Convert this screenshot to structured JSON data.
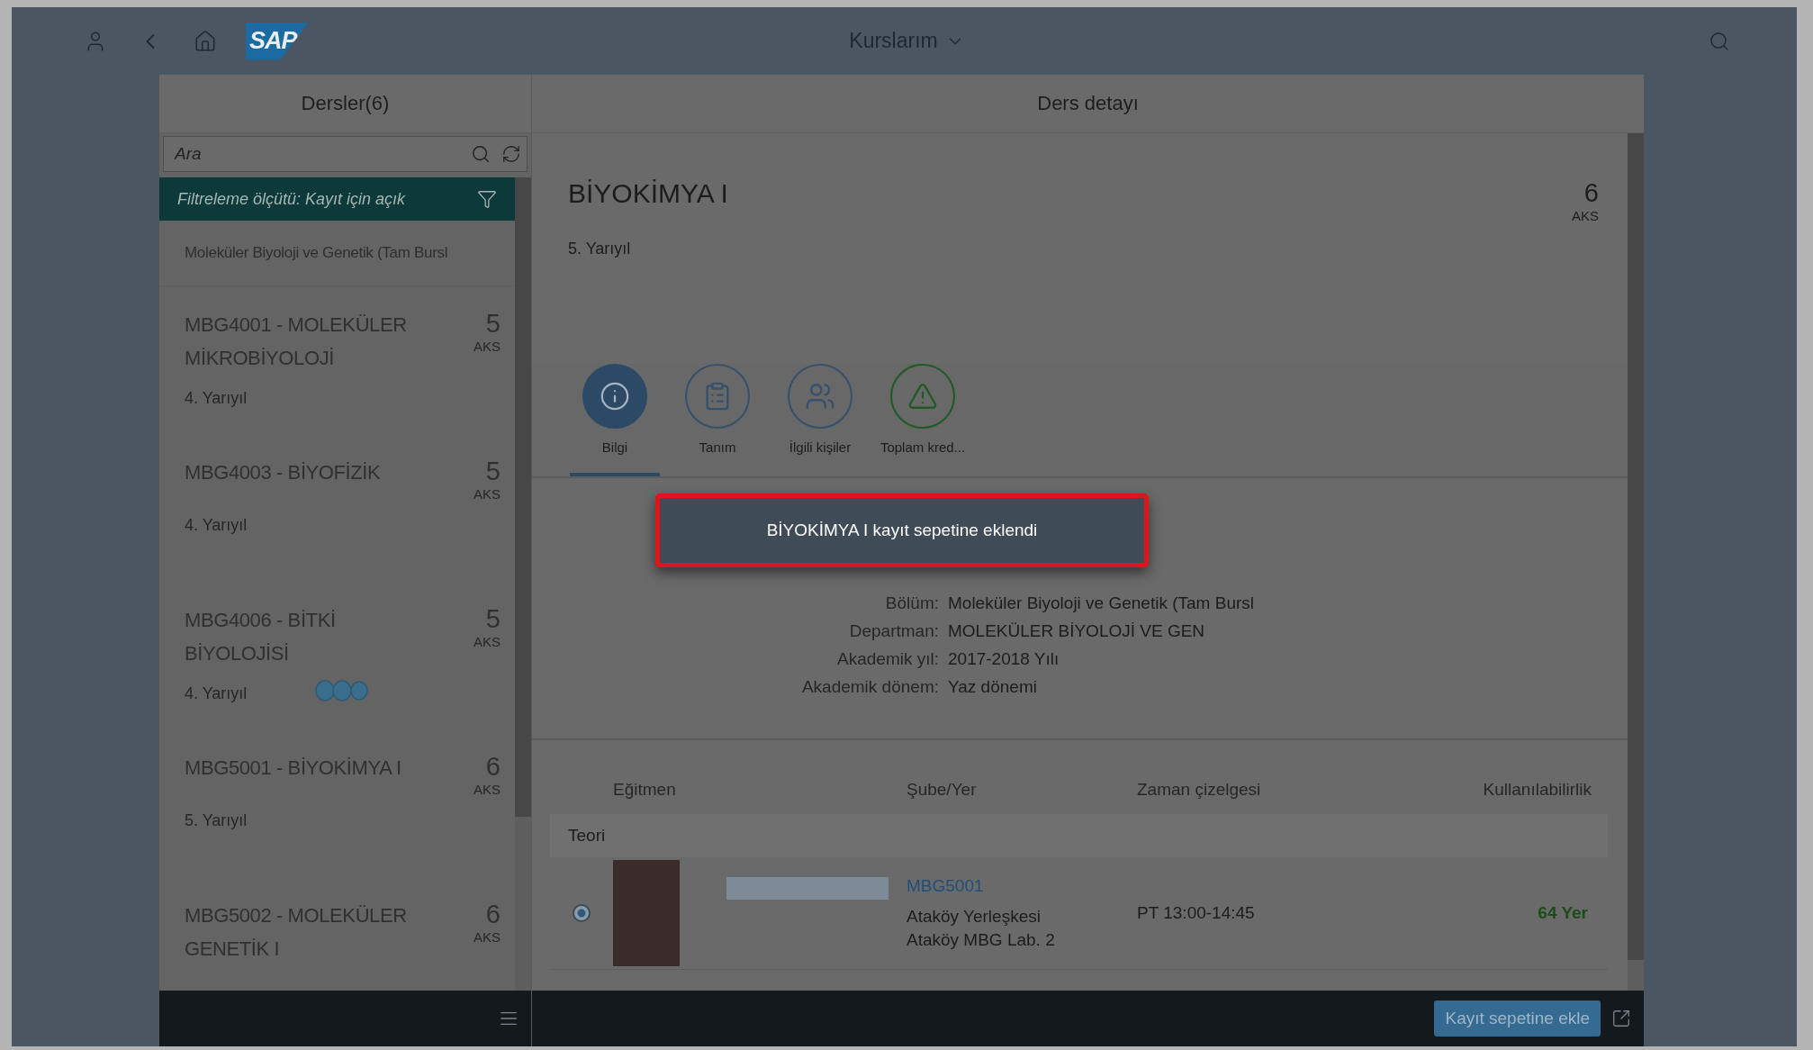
{
  "shell": {
    "logo": "SAP",
    "title": "Kurslarım"
  },
  "master": {
    "title": "Dersler(6)",
    "search": {
      "placeholder": "Ara"
    },
    "filter": "Filtreleme ölçütü: Kayıt için açık",
    "group": "Moleküler Biyoloji ve Genetik (Tam Bursl",
    "items": [
      {
        "title": "MBG4001 - MOLEKÜLER MİKROBİYOLOJİ",
        "credits": "5",
        "unit": "AKS",
        "semester": "4. Yarıyıl",
        "loading": false
      },
      {
        "title": "MBG4003 - BİYOFİZİK",
        "credits": "5",
        "unit": "AKS",
        "semester": "4. Yarıyıl",
        "loading": false
      },
      {
        "title": "MBG4006 - BİTKİ BİYOLOJİSİ",
        "credits": "5",
        "unit": "AKS",
        "semester": "4. Yarıyıl",
        "loading": true
      },
      {
        "title": "MBG5001 - BİYOKİMYA I",
        "credits": "6",
        "unit": "AKS",
        "semester": "5. Yarıyıl",
        "loading": false
      },
      {
        "title": "MBG5002 - MOLEKÜLER GENETİK I",
        "credits": "6",
        "unit": "AKS"
      }
    ]
  },
  "detail": {
    "title": "Ders detayı",
    "course": "BİYOKİMYA I",
    "credits": "6",
    "unit": "AKS",
    "semester": "5. Yarıyıl",
    "tabs": [
      {
        "label": "Bilgi",
        "selected": true,
        "color": "#2c4a66"
      },
      {
        "label": "Tanım",
        "selected": false,
        "color": "#34506a"
      },
      {
        "label": "İlgili kişiler",
        "selected": false,
        "color": "#34506a"
      },
      {
        "label": "Toplam kred...",
        "selected": false,
        "color": "#1f5a25"
      }
    ],
    "fields": [
      {
        "label": "Bölüm:",
        "value": "Moleküler Biyoloji ve Genetik (Tam Bursl"
      },
      {
        "label": "Departman:",
        "value": "MOLEKÜLER BİYOLOJİ VE GEN"
      },
      {
        "label": "Akademik yıl:",
        "value": "2017-2018 Yılı"
      },
      {
        "label": "Akademik dönem:",
        "value": "Yaz dönemi"
      }
    ],
    "table": {
      "columns": [
        "Eğitmen",
        "Şube/Yer",
        "Zaman çizelgesi",
        "Kullanılabilirlik"
      ],
      "group": "Teori",
      "rows": [
        {
          "selected": true,
          "section": "MBG5001",
          "location": [
            "Ataköy Yerleşkesi",
            "Ataköy MBG Lab. 2"
          ],
          "time": "PT 13:00-14:45",
          "availability": "64 Yer"
        }
      ]
    },
    "footer": {
      "button": "Kayıt sepetine ekle"
    }
  },
  "toast": {
    "message": "BİYOKİMYA I kayıt sepetine eklendi"
  }
}
